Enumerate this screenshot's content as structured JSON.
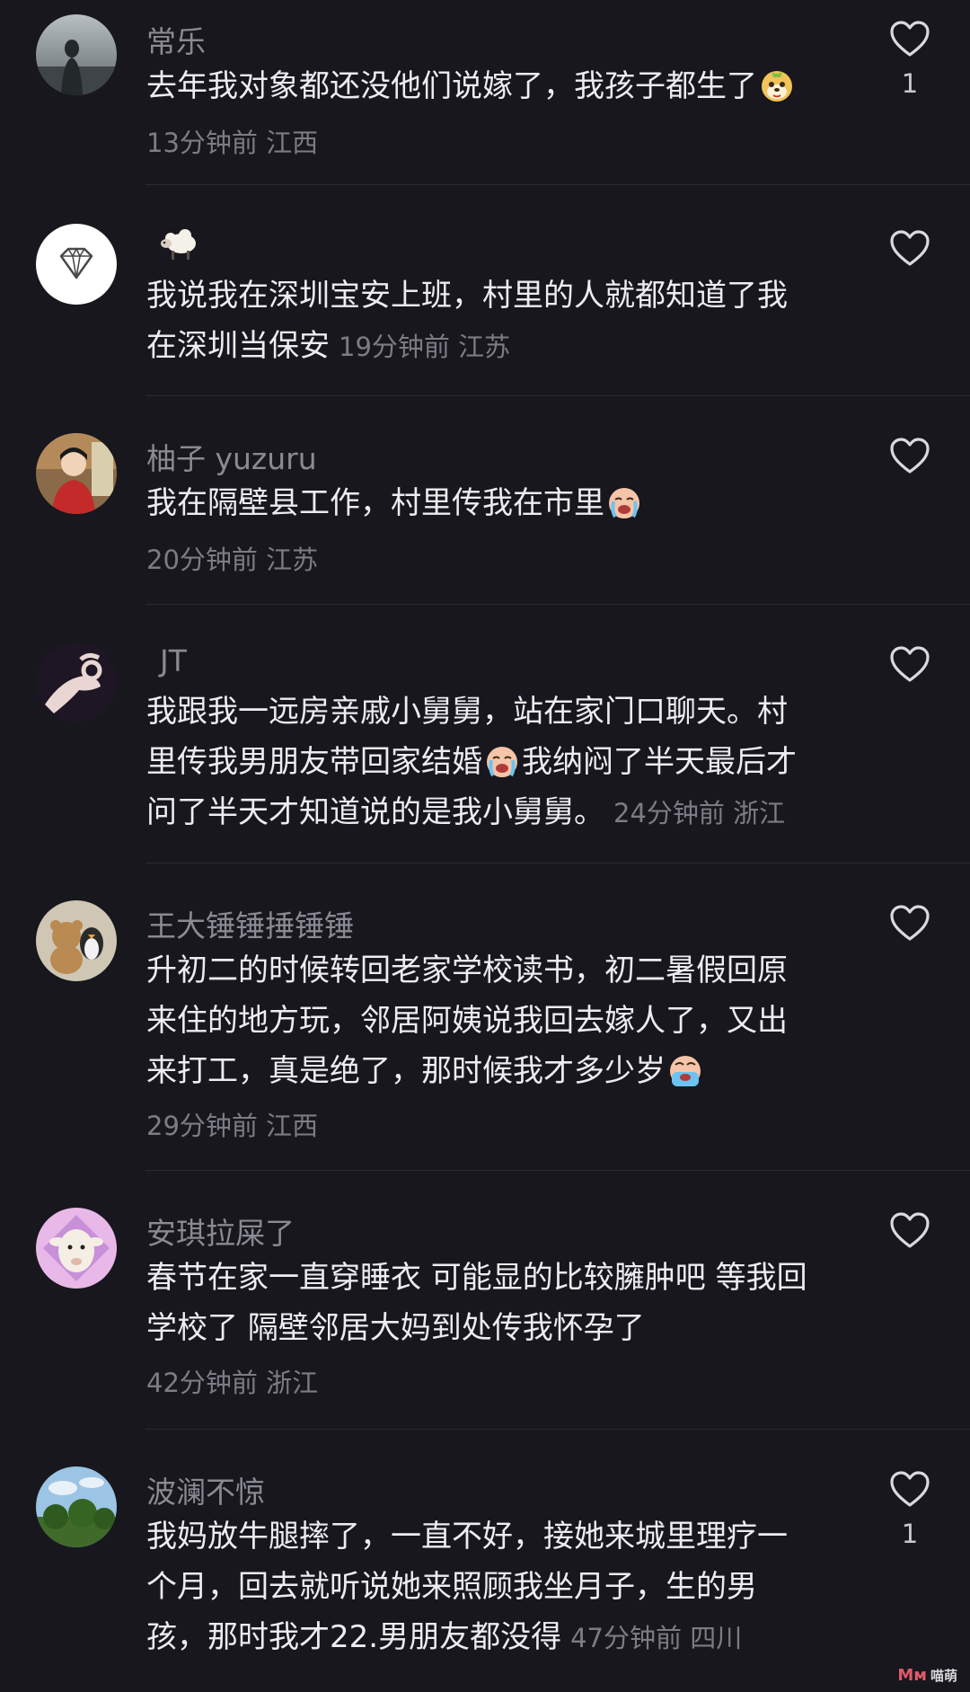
{
  "comments": [
    {
      "username": "常乐",
      "text": "去年我对象都还没他们说嫁了，我孩子都生了",
      "time": "13分钟前",
      "location": "江西",
      "likes": "1",
      "avatar": "silhouette-avatar"
    },
    {
      "username": "",
      "text_line1": "我说我在深圳宝安上班，村里的人就都知道了我",
      "text_line2": "在深圳当保安",
      "time": "19分钟前",
      "location": "江苏",
      "avatar": "diamond-avatar"
    },
    {
      "username": "柚子 yuzuru",
      "text": "我在隔壁县工作，村里传我在市里",
      "time": "20分钟前",
      "location": "江苏",
      "avatar": "person-avatar"
    },
    {
      "username": "JT",
      "text_line1": "我跟我一远房亲戚小舅舅，站在家门口聊天。村",
      "text_line2a": "里传我男朋友带回家结婚",
      "text_line2b": "我纳闷了半天最后才",
      "text_line3": "问了半天才知道说的是我小舅舅。",
      "time": "24分钟前",
      "location": "浙江",
      "avatar": "hand-avatar"
    },
    {
      "username": "王大锤锤捶锤锤",
      "text_line1": "升初二的时候转回老家学校读书，初二暑假回原",
      "text_line2": "来住的地方玩，邻居阿姨说我回去嫁人了，又出",
      "text_line3": "来打工，真是绝了，那时候我才多少岁",
      "time": "29分钟前",
      "location": "江西",
      "avatar": "plush-avatar"
    },
    {
      "username": "安琪拉屎了",
      "text_line1": "春节在家一直穿睡衣 可能显的比较臃肿吧 等我回",
      "text_line2": "学校了 隔壁邻居大妈到处传我怀孕了",
      "time": "42分钟前",
      "location": "浙江",
      "avatar": "lamb-avatar"
    },
    {
      "username": "波澜不惊",
      "text_line1": "我妈放牛腿摔了，一直不好，接她来城里理疗一",
      "text_line2": "个月，回去就听说她来照顾我坐月子，生的男",
      "text_line3": "孩，那时我才22.男朋友都没得",
      "time": "47分钟前",
      "location": "四川",
      "likes": "1",
      "avatar": "landscape-avatar"
    }
  ],
  "watermark": {
    "logo": "Mᴍ",
    "text": "喵萌"
  },
  "icons": {
    "like": "heart-outline-icon"
  },
  "colors": {
    "background": "#17171d",
    "username": "#8a8a94",
    "text": "#ececf1",
    "meta": "#7c7c86"
  }
}
